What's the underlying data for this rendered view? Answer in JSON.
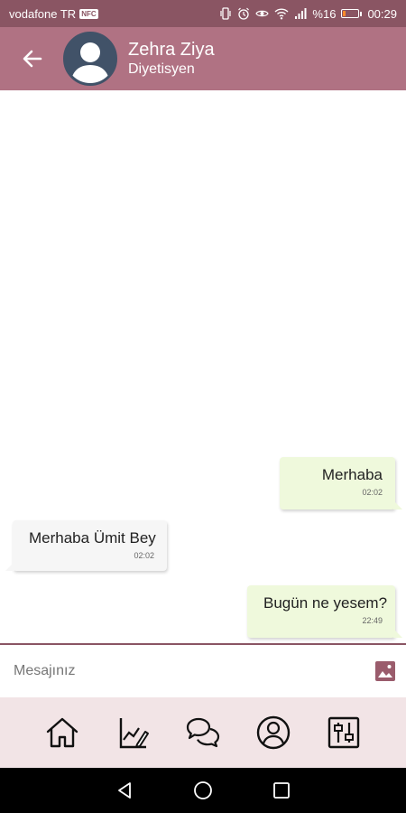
{
  "status_bar": {
    "carrier": "vodafone TR",
    "network_badge": "NFC",
    "battery": "%16",
    "battery_level": 0.16,
    "time": "00:29"
  },
  "header": {
    "contact_name": "Zehra Ziya",
    "contact_role": "Diyetisyen"
  },
  "messages": [
    {
      "direction": "outgoing",
      "text": "Merhaba",
      "time": "02:02"
    },
    {
      "direction": "incoming",
      "text": "Merhaba Ümit Bey",
      "time": "02:02"
    },
    {
      "direction": "outgoing",
      "text": "Bugün ne yesem?",
      "time": "22:49"
    }
  ],
  "input": {
    "placeholder": "Mesajınız",
    "value": ""
  },
  "bottom_nav": {
    "items": [
      {
        "icon": "home-icon"
      },
      {
        "icon": "progress-chart-icon"
      },
      {
        "icon": "chat-bubbles-icon"
      },
      {
        "icon": "profile-icon"
      },
      {
        "icon": "settings-sliders-icon"
      }
    ]
  },
  "colors": {
    "status_bar": "#8a5563",
    "header": "#b07283",
    "outgoing_bubble": "#eff9dc",
    "incoming_bubble": "#f6f6f6",
    "nav_bg": "#f2e4e6",
    "accent": "#8a5563"
  }
}
